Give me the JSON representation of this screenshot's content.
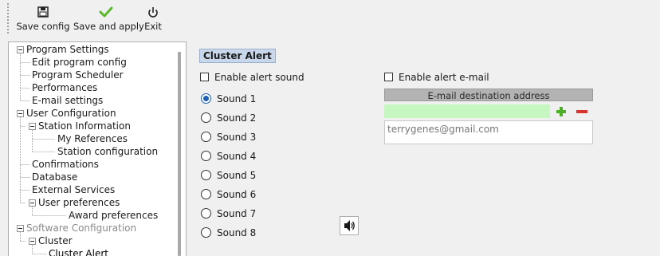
{
  "toolbar": {
    "save_config_label": "Save config",
    "save_apply_label": "Save and apply",
    "exit_label": "Exit",
    "icons": {
      "save": "floppy-disk-icon",
      "apply": "green-check-icon",
      "exit": "power-icon"
    }
  },
  "tree": {
    "items": [
      {
        "label": "Program Settings",
        "expanded": true
      },
      {
        "label": "Edit program config"
      },
      {
        "label": "Program Scheduler"
      },
      {
        "label": "Performances"
      },
      {
        "label": "E-mail settings"
      },
      {
        "label": "User Configuration",
        "expanded": true
      },
      {
        "label": "Station Information",
        "expanded": true
      },
      {
        "label": "My References"
      },
      {
        "label": "Station configuration"
      },
      {
        "label": "Confirmations"
      },
      {
        "label": "Database"
      },
      {
        "label": "External Services"
      },
      {
        "label": "User preferences",
        "expanded": true
      },
      {
        "label": "Award preferences"
      },
      {
        "label": "Software Configuration",
        "expanded": true,
        "disabled": true
      },
      {
        "label": "Cluster",
        "expanded": true
      },
      {
        "label": "Cluster Alert",
        "selected": true
      }
    ]
  },
  "panel": {
    "title": "Cluster Alert",
    "enable_sound_label": "Enable alert sound",
    "enable_sound_checked": false,
    "enable_email_label": "Enable alert e-mail",
    "enable_email_checked": false,
    "sounds": [
      {
        "label": "Sound 1",
        "checked": true
      },
      {
        "label": "Sound 2",
        "checked": false
      },
      {
        "label": "Sound 3",
        "checked": false
      },
      {
        "label": "Sound 4",
        "checked": false
      },
      {
        "label": "Sound 5",
        "checked": false
      },
      {
        "label": "Sound 6",
        "checked": false
      },
      {
        "label": "Sound 7",
        "checked": false
      },
      {
        "label": "Sound 8",
        "checked": false
      }
    ],
    "play_icon": "speaker-icon",
    "email_header": "E-mail destination address",
    "email_input_value": "",
    "email_list": [
      "terrygenes@gmail.com"
    ],
    "colors": {
      "input_bg": "#c6f7c0",
      "add": "#4caf27",
      "remove": "#d9342b",
      "radio_selected": "#1e5fb3"
    }
  }
}
